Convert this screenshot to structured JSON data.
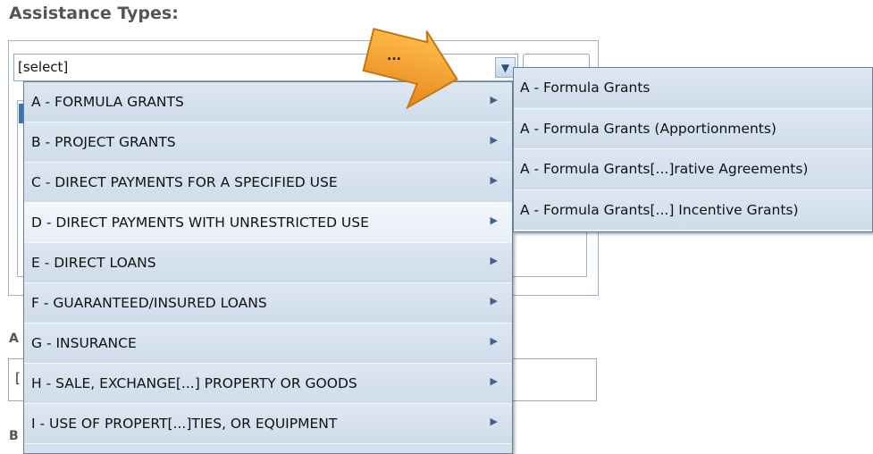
{
  "heading": "Assistance Types:",
  "select": {
    "value": "[select]"
  },
  "side_letters": {
    "a": "A",
    "b": "B",
    "bracket": "["
  },
  "lower_input": {
    "value": "["
  },
  "callout": {
    "text": "...",
    "color": "#f29a1f"
  },
  "menu": {
    "items": [
      {
        "label": "A - FORMULA GRANTS",
        "highlighted": false
      },
      {
        "label": "B - PROJECT GRANTS",
        "highlighted": false
      },
      {
        "label": "C - DIRECT PAYMENTS FOR A SPECIFIED USE",
        "highlighted": false
      },
      {
        "label": "D - DIRECT PAYMENTS WITH UNRESTRICTED USE",
        "highlighted": true
      },
      {
        "label": "E - DIRECT LOANS",
        "highlighted": false
      },
      {
        "label": "F - GUARANTEED/INSURED LOANS",
        "highlighted": false
      },
      {
        "label": "G - INSURANCE",
        "highlighted": false
      },
      {
        "label": "H - SALE, EXCHANGE[...] PROPERTY OR GOODS",
        "highlighted": false
      },
      {
        "label": "I - USE OF PROPERT[...]TIES, OR EQUIPMENT",
        "highlighted": false
      }
    ],
    "arrow_glyph": "▶"
  },
  "submenu": {
    "items": [
      {
        "label": "A - Formula Grants"
      },
      {
        "label": "A - Formula Grants (Apportionments)"
      },
      {
        "label": "A - Formula Grants[...]rative Agreements)"
      },
      {
        "label": "A - Formula Grants[...] Incentive Grants)"
      }
    ]
  },
  "icons": {
    "dropdown_arrow": "chevron-down-icon",
    "submenu_arrow": "triangle-right-icon",
    "callout": "arrow-callout-icon"
  }
}
